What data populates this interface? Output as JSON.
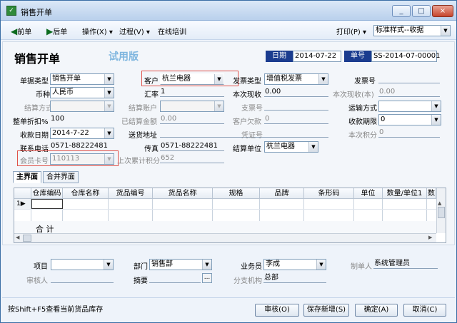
{
  "window": {
    "title": "销售开单",
    "minimize": "_",
    "maximize": "□",
    "close": "×"
  },
  "toolbar": {
    "prev": "前单",
    "next": "后单",
    "operation": "操作(X)",
    "process": "过程(V)",
    "training": "在线培训",
    "print": "打印(P)",
    "print_style": "标准样式--收据"
  },
  "header": {
    "title": "销售开单",
    "trial": "试用版",
    "date_label": "日期",
    "date_value": "2014-07-22",
    "order_label": "单号",
    "order_value": "SS-2014-07-00001"
  },
  "fields": {
    "doc_type_label": "单据类型",
    "doc_type_value": "销售开单",
    "customer_label": "客户",
    "customer_value": "杭兰电器",
    "invoice_type_label": "发票类型",
    "invoice_type_value": "增值税发票",
    "invoice_no_label": "发票号",
    "currency_label": "币种",
    "currency_value": "人民币",
    "rate_label": "汇率",
    "rate_value": "1",
    "receive_now_label": "本次现收",
    "receive_now_value": "0.00",
    "receive_now_base_label": "本次现收(本)",
    "receive_now_base_value": "0.00",
    "settle_method_label": "结算方式",
    "settle_account_label": "结算账户",
    "cheque_label": "支票号",
    "transport_label": "运输方式",
    "discount_label": "整单折扣%",
    "discount_value": "100",
    "settled_amount_label": "已结算金额",
    "settled_amount_value": "0.00",
    "customer_debt_label": "客户欠款",
    "customer_debt_value": "0",
    "due_days_label": "收款期限",
    "due_days_value": "0",
    "receive_date_label": "收款日期",
    "receive_date_value": "2014-7-22",
    "ship_addr_label": "送货地址",
    "voucher_label": "凭证号",
    "points_label": "本次积分",
    "points_value": "0",
    "phone_label": "联系电话",
    "phone_value": "0571-88222481",
    "fax_label": "传真",
    "fax_value": "0571-88222481",
    "settle_unit_label": "结算单位",
    "settle_unit_value": "杭兰电器",
    "member_card_label": "会员卡号",
    "member_card_value": "110113",
    "accum_points_label": "上次累计积分",
    "accum_points_value": "652"
  },
  "tabs": {
    "main": "主界面",
    "merged": "合并界面"
  },
  "grid": {
    "columns": [
      "仓库编码",
      "仓库名称",
      "货品编号",
      "货品名称",
      "规格",
      "品牌",
      "条形码",
      "单位",
      "数量/单位1",
      "数"
    ],
    "row_number": "1",
    "row_marker": "▶",
    "total_label": "合 计"
  },
  "footer_fields": {
    "project_label": "项目",
    "dept_label": "部门",
    "dept_value": "销售部",
    "salesman_label": "业务员",
    "salesman_value": "李成",
    "maker_label": "制单人",
    "maker_value": "系统管理员",
    "auditor_label": "审核人",
    "summary_label": "摘要",
    "branch_label": "分支机构",
    "branch_value": "总部",
    "ellipsis": "..."
  },
  "status": {
    "hint": "按Shift+F5查看当前货品库存"
  },
  "buttons": {
    "audit": "审核(O)",
    "save_new": "保存新增(S)",
    "ok": "确定(A)",
    "cancel": "取消(C)"
  },
  "colors": {
    "accent": "#1b3c8f",
    "highlight": "#e0524a",
    "trial": "#7fb6df"
  }
}
